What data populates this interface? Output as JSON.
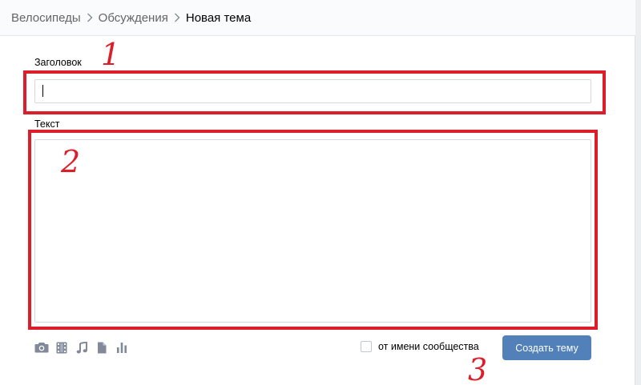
{
  "breadcrumb": {
    "items": [
      "Велосипеды",
      "Обсуждения"
    ],
    "current": "Новая тема"
  },
  "form": {
    "title_label": "Заголовок",
    "title_value": "",
    "text_label": "Текст",
    "text_value": "",
    "community_checkbox_label": "от имени сообщества",
    "community_checked": false,
    "submit_label": "Создать тему"
  },
  "attachments": [
    "camera-icon",
    "video-icon",
    "music-icon",
    "document-icon",
    "poll-icon"
  ],
  "annotations": [
    "1",
    "2",
    "3"
  ],
  "colors": {
    "accent": "#5181b8",
    "annotation": "#dc1e2a",
    "icon": "#828a99"
  }
}
